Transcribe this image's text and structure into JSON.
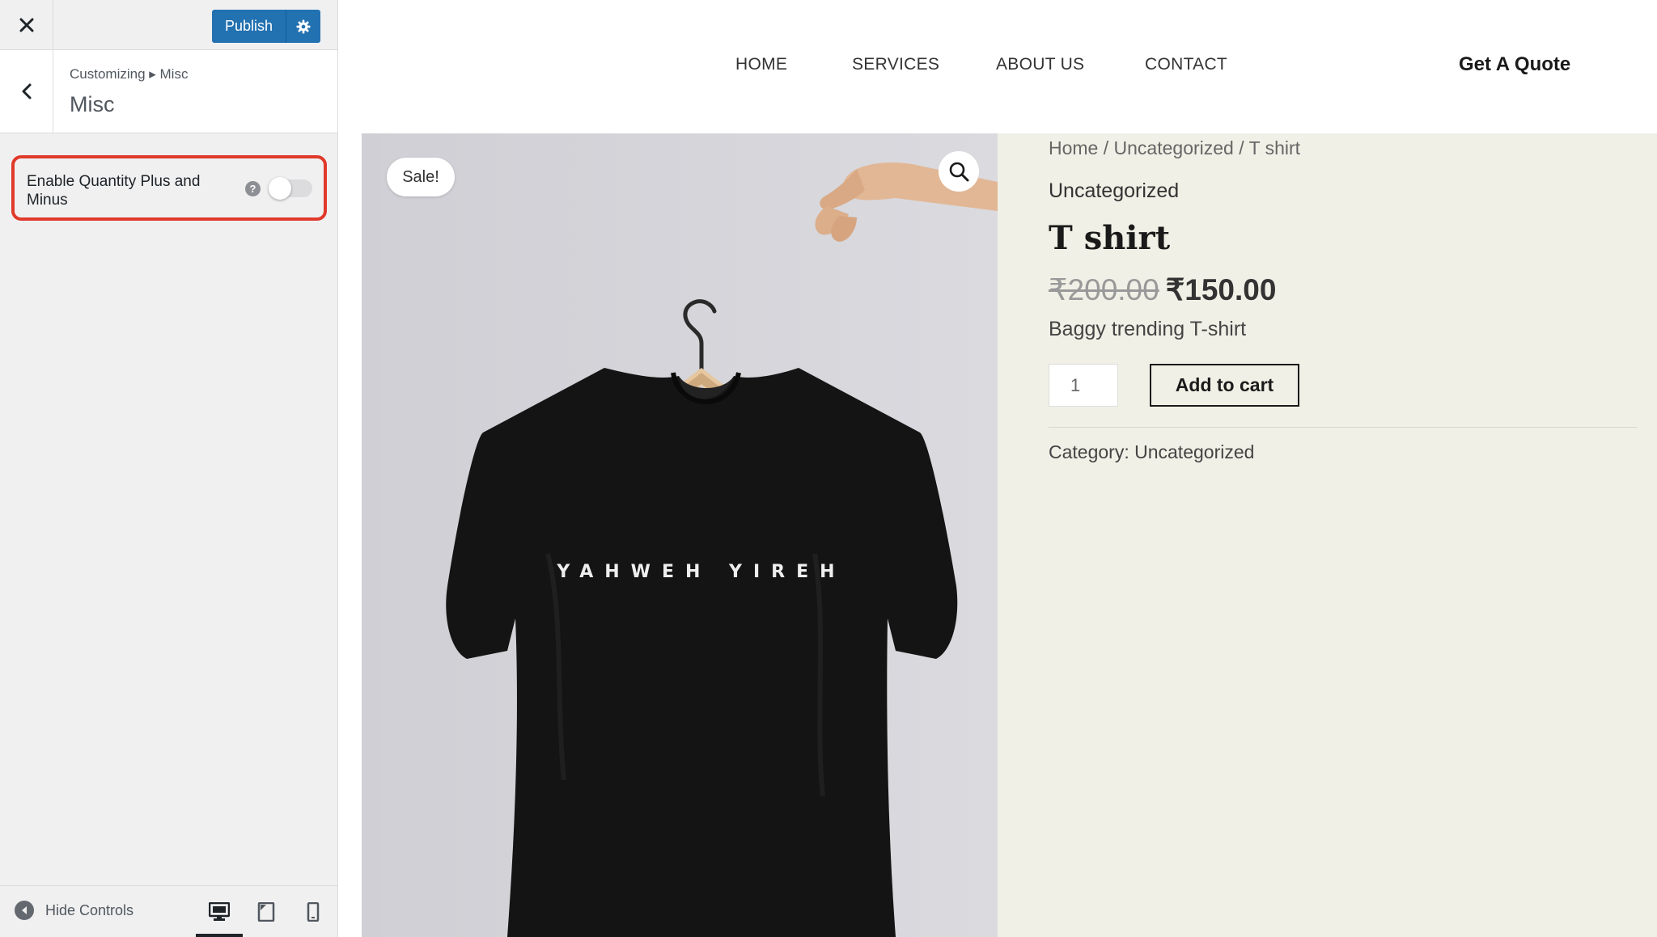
{
  "customizer": {
    "publish_label": "Publish",
    "breadcrumb": "Customizing ▸ Misc",
    "section_title": "Misc",
    "control": {
      "label": "Enable Quantity Plus and Minus",
      "help": "?",
      "toggle_state": "off"
    },
    "footer": {
      "hide_controls_label": "Hide Controls",
      "devices": [
        "desktop",
        "tablet",
        "mobile"
      ],
      "active_device": "desktop"
    },
    "colors": {
      "primary": "#2271b1",
      "highlight": "#e03a2b"
    }
  },
  "site": {
    "nav": [
      "HOME",
      "SERVICES",
      "ABOUT US",
      "CONTACT"
    ],
    "cta": "Get A Quote"
  },
  "product": {
    "sale_badge": "Sale!",
    "breadcrumb": "Home / Uncategorized / T shirt",
    "category": "Uncategorized",
    "title": "T shirt",
    "price_old": "₹200.00",
    "price_new": "₹150.00",
    "short_description": "Baggy trending T-shirt",
    "quantity": "1",
    "add_to_cart_label": "Add to cart",
    "meta_category": "Category: Uncategorized",
    "image_shirt_text": "YAHWEH YIREH",
    "summary_bg": "#f0f0e6"
  }
}
